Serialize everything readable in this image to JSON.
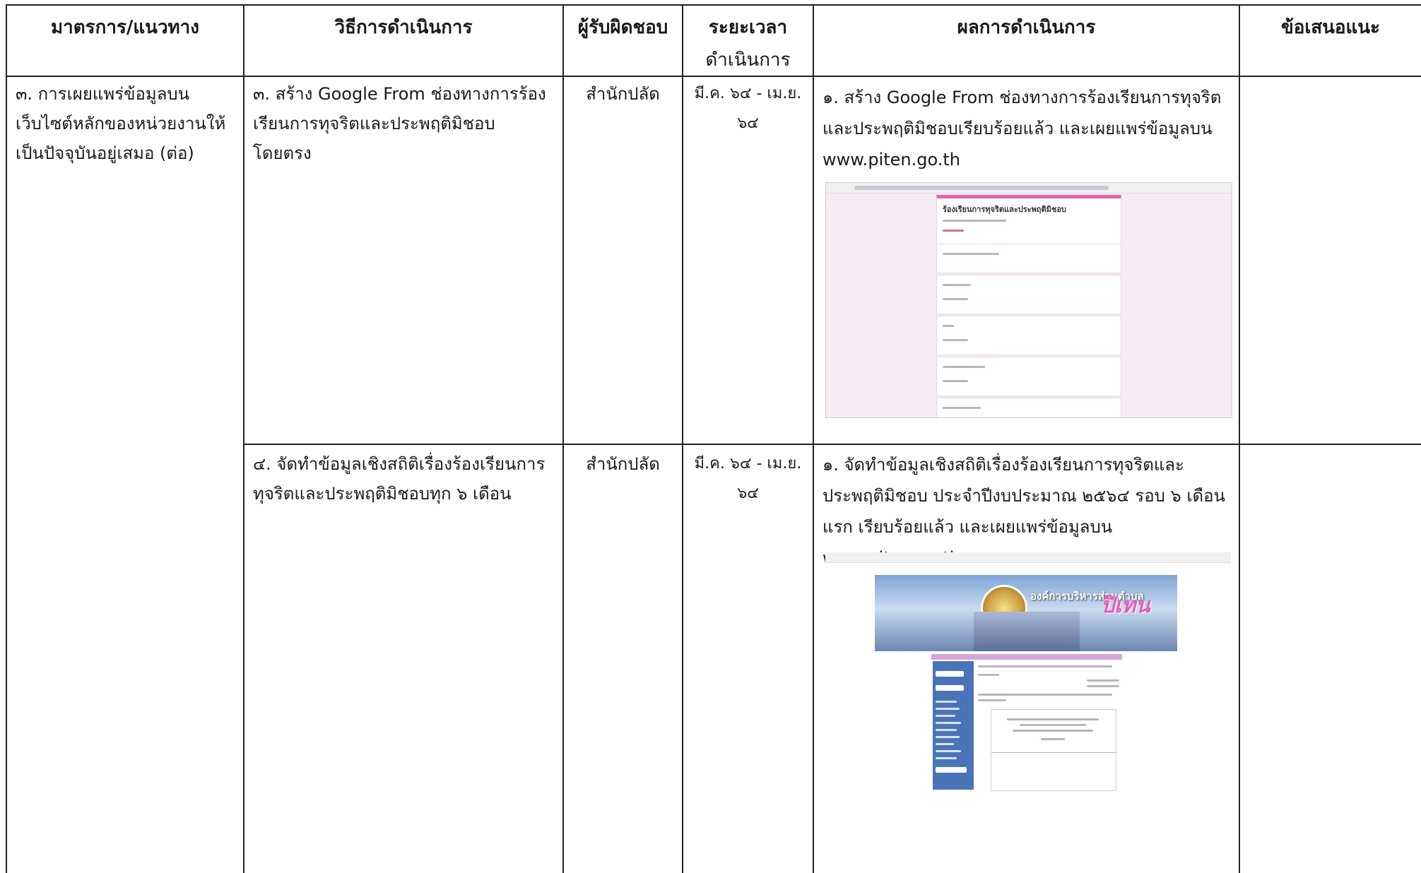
{
  "headers": {
    "measure": "มาตรการ/แนวทาง",
    "method": "วิธีการดำเนินการ",
    "responsible": "ผู้รับผิดชอบ",
    "period_line1": "ระยะเวลา",
    "period_line2": "ดำเนินการ",
    "result": "ผลการดำเนินการ",
    "suggestion": "ข้อเสนอแนะ"
  },
  "rows": [
    {
      "measure": "๓. การเผยแพร่ข้อมูลบนเว็บไซต์หลักของหน่วยงานให้เป็นปัจจุบันอยู่เสมอ (ต่อ)",
      "method": "๓. สร้าง Google From ช่องทางการร้องเรียนการทุจริตและประพฤติมิชอบ โดยตรง",
      "responsible": "สำนักปลัด",
      "period": "มี.ค. ๖๔ - เม.ย. ๖๔",
      "result": "๑. สร้าง Google From ช่องทางการร้องเรียนการทุจริตและประพฤติมิชอบเรียบร้อยแล้ว และเผยแพร่ข้อมูลบน www.piten.go.th",
      "screenshot": {
        "form_title": "ร้องเรียนการทุจริตและประพฤติมิชอบ",
        "accent": "#e064b0"
      }
    },
    {
      "method": "๔. จัดทำข้อมูลเชิงสถิติเรื่องร้องเรียนการทุจริตและประพฤติมิชอบทุก ๖ เดือน",
      "responsible": "สำนักปลัด",
      "period": "มี.ค. ๖๔ - เม.ย. ๖๔",
      "result": "๑. จัดทำข้อมูลเชิงสถิติเรื่องร้องเรียนการทุจริตและประพฤติมิชอบ ประจำปีงบประมาณ ๒๕๖๔ รอบ ๖ เดือนแรก เรียบร้อยแล้ว และเผยแพร่ข้อมูลบน www.piten.go.th",
      "screenshot": {
        "banner_title": "องค์การบริหารส่วนตำบล",
        "banner_name": "ปิเทน",
        "banner_color": "#7fa4d6"
      }
    }
  ]
}
